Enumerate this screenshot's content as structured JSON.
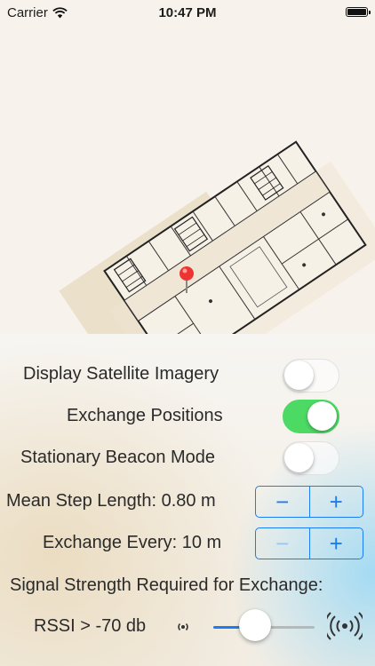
{
  "status_bar": {
    "carrier": "Carrier",
    "time": "10:47 PM",
    "battery_level": 1.0
  },
  "map": {
    "pin_color": "#ee3333"
  },
  "settings": {
    "satellite": {
      "label": "Display Satellite Imagery",
      "on": false
    },
    "exchange_positions": {
      "label": "Exchange Positions",
      "on": true
    },
    "stationary_beacon": {
      "label": "Stationary Beacon Mode",
      "on": false
    },
    "step_length": {
      "label": "Mean Step Length: 0.80 m",
      "minus": "−",
      "plus": "+"
    },
    "exchange_every": {
      "label": "Exchange Every: 10 m",
      "minus": "−",
      "plus": "+",
      "minus_enabled": false
    },
    "signal_heading": "Signal Strength Required for Exchange:",
    "rssi": {
      "label": "RSSI > -70 db",
      "slider_fraction": 0.41
    }
  },
  "colors": {
    "switch_on": "#4cd964",
    "tint": "#1e7cf2"
  },
  "icons": {
    "wifi": "wifi-icon",
    "signal_low": "signal-low-icon",
    "signal_high": "signal-high-icon"
  }
}
